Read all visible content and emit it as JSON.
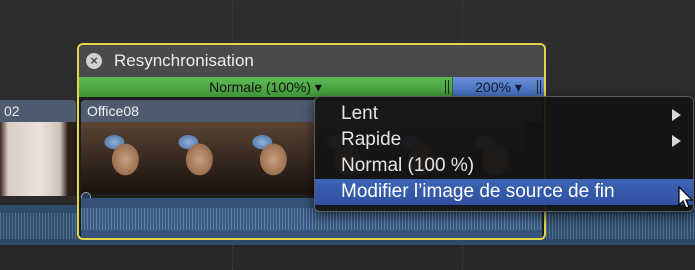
{
  "prev_clip": {
    "label": "02"
  },
  "retime": {
    "title": "Resynchronisation",
    "close_glyph": "×",
    "speed_normal": "Normale (100%) ▾",
    "speed_fast": "200% ▾"
  },
  "clip": {
    "label": "Office08"
  },
  "menu": {
    "items": [
      {
        "label": "Lent",
        "submenu": true
      },
      {
        "label": "Rapide",
        "submenu": true
      },
      {
        "label": "Normal (100 %)",
        "submenu": false
      },
      {
        "label": "Modifier l’image de source de fin",
        "submenu": false,
        "selected": true
      }
    ]
  },
  "colors": {
    "retime_border": "#e1d54a",
    "speed_normal": "#4fa846",
    "speed_fast": "#5079c7",
    "menu_selection": "#3d64b4"
  },
  "icons": {
    "close": "close-icon",
    "submenu": "chevron-right-icon",
    "cursor": "mouse-pointer-icon"
  }
}
